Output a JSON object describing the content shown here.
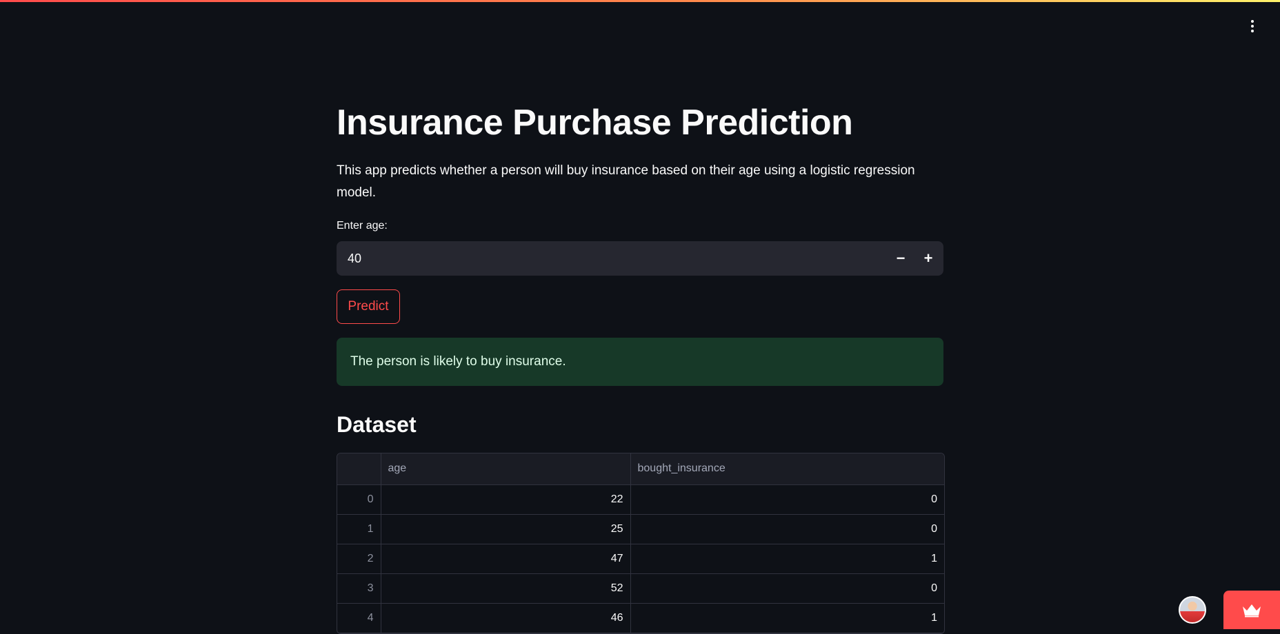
{
  "header": {
    "menu_icon": "kebab-menu-icon"
  },
  "main": {
    "title": "Insurance Purchase Prediction",
    "description": "This app predicts whether a person will buy insurance based on their age using a logistic regression model.",
    "age_input": {
      "label": "Enter age:",
      "value": "40",
      "decrement_label": "−",
      "increment_label": "+"
    },
    "predict_button": "Predict",
    "result_message": "The person is likely to buy insurance.",
    "dataset_title": "Dataset"
  },
  "table": {
    "columns": [
      "",
      "age",
      "bought_insurance"
    ],
    "rows": [
      {
        "index": "0",
        "age": "22",
        "bought_insurance": "0"
      },
      {
        "index": "1",
        "age": "25",
        "bought_insurance": "0"
      },
      {
        "index": "2",
        "age": "47",
        "bought_insurance": "1"
      },
      {
        "index": "3",
        "age": "52",
        "bought_insurance": "0"
      },
      {
        "index": "4",
        "age": "46",
        "bought_insurance": "1"
      }
    ]
  },
  "footer": {
    "avatar_icon": "user-avatar",
    "badge_icon": "crown-icon"
  },
  "colors": {
    "background": "#0e1117",
    "accent": "#ff4b4b",
    "success_bg": "#173928",
    "input_bg": "#262730"
  }
}
